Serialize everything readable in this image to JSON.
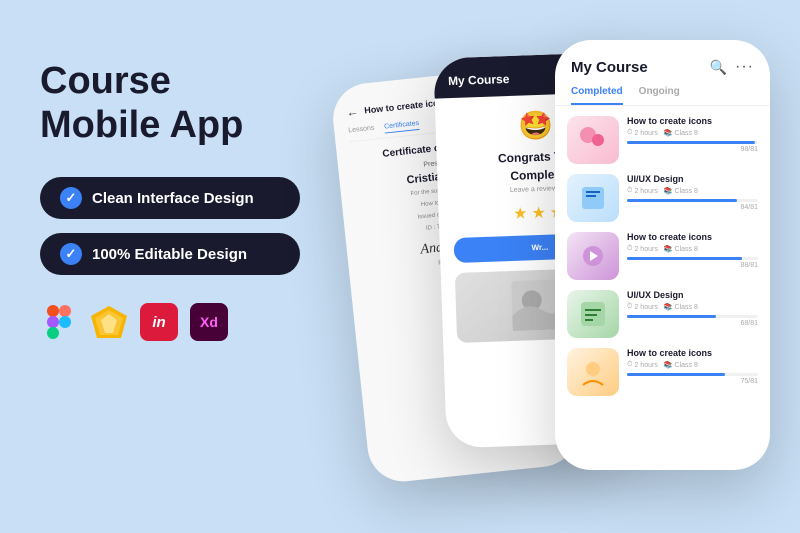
{
  "app": {
    "title_line1": "Course",
    "title_line2": "Mobile App",
    "background_color": "#c8dff5"
  },
  "features": [
    {
      "id": "clean-interface",
      "label": "Clean Interface Design"
    },
    {
      "id": "editable-design",
      "label": "100% Editable Design"
    }
  ],
  "tools": [
    {
      "id": "figma",
      "label": "Figma",
      "color": "#000"
    },
    {
      "id": "sketch",
      "label": "Sketch",
      "color": "#f7b500"
    },
    {
      "id": "invision",
      "label": "in",
      "color": "#dc1a3c"
    },
    {
      "id": "xd",
      "label": "Xd",
      "color": "#ff61f6"
    }
  ],
  "phones": {
    "back": {
      "nav_back": "←",
      "tab_lessons": "Lessons",
      "tab_certificates": "Certificates",
      "tab_active": "Certificates",
      "cert_title": "Certificate of Completion",
      "cert_presented": "Presented to",
      "cert_name": "Cristian Johan",
      "cert_for": "For the successful compl...",
      "cert_course": "How to Create Ico...",
      "cert_issued": "Issued on May 24, 20...",
      "cert_id": "ID : 7E1E8988B...",
      "cert_signature": "Andrew J...",
      "cert_footer": "Film Cour..."
    },
    "mid": {
      "header_title": "My Course",
      "header_dots": "···",
      "emoji": "🤩",
      "congrats_text": "Congrats You",
      "congrats_text2": "Comple...",
      "leave_review": "Leave a review →",
      "stars": [
        "★",
        "★",
        "★"
      ],
      "cta_button": "Wr...",
      "image_alt": "Course completion image"
    },
    "front": {
      "header_title": "My Course",
      "search_icon": "🔍",
      "more_icon": "···",
      "tabs": [
        {
          "label": "Completed",
          "active": true
        },
        {
          "label": "Ongoing",
          "active": false
        }
      ],
      "courses": [
        {
          "name": "How to create icons",
          "hours": "2 hours",
          "class": "Class 8",
          "progress": 98,
          "progress_label": "98/81",
          "thumb_style": "thumb-icons"
        },
        {
          "name": "UI/UX Design",
          "hours": "2 hours",
          "class": "Class 8",
          "progress": 84,
          "progress_label": "84/81",
          "thumb_style": "thumb-design"
        },
        {
          "name": "How to create icons",
          "hours": "2 hours",
          "class": "Class 8",
          "progress": 88,
          "progress_label": "88/81",
          "thumb_style": "thumb-create"
        },
        {
          "name": "UI/UX Design",
          "hours": "2 hours",
          "class": "Class 8",
          "progress": 68,
          "progress_label": "68/81",
          "thumb_style": "thumb-ux"
        },
        {
          "name": "How to create icons",
          "hours": "2 hours",
          "class": "Class 8",
          "progress": 75,
          "progress_label": "75/81",
          "thumb_style": "thumb-how"
        }
      ]
    }
  }
}
